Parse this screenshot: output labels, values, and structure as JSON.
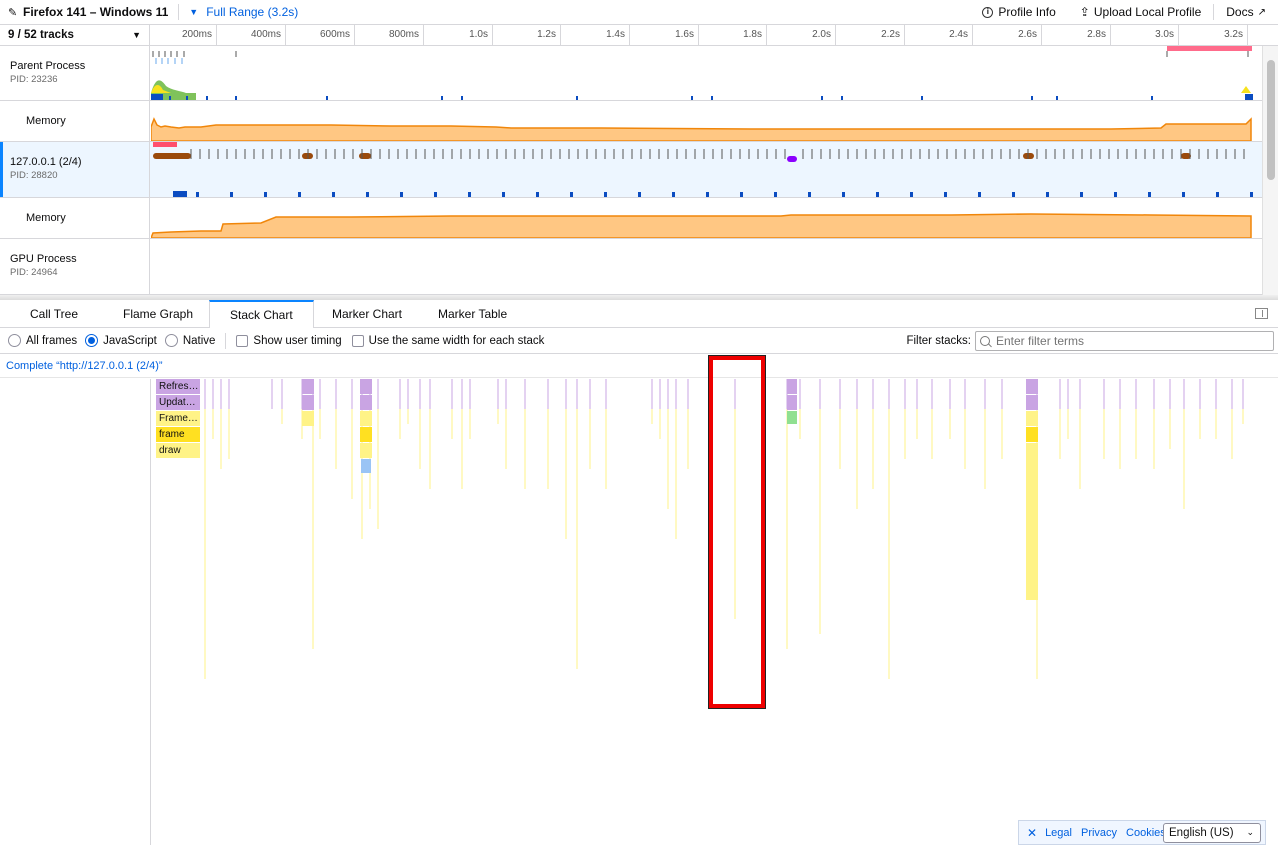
{
  "topbar": {
    "title": "Firefox 141 – Windows 11",
    "range": "Full Range (3.2s)",
    "profile_info": "Profile Info",
    "upload": "Upload Local Profile",
    "docs": "Docs"
  },
  "timeline": {
    "tracks_count": "9 / 52 tracks",
    "ticks": [
      "200ms",
      "400ms",
      "600ms",
      "800ms",
      "1.0s",
      "1.2s",
      "1.4s",
      "1.6s",
      "1.8s",
      "2.0s",
      "2.2s",
      "2.4s",
      "2.6s",
      "2.8s",
      "3.0s",
      "3.2s"
    ],
    "tracks": [
      {
        "name": "Parent Process",
        "pid": "PID: 23236"
      },
      {
        "name": "Memory"
      },
      {
        "name": "127.0.0.1 (2/4)",
        "pid": "PID: 28820"
      },
      {
        "name": "Memory"
      },
      {
        "name": "GPU Process",
        "pid": "PID: 24964"
      }
    ]
  },
  "tabs": [
    "Call Tree",
    "Flame Graph",
    "Stack Chart",
    "Marker Chart",
    "Marker Table"
  ],
  "active_tab": "Stack Chart",
  "settings": {
    "all_frames": "All frames",
    "javascript": "JavaScript",
    "native": "Native",
    "selected": "JavaScript",
    "show_user_timing": "Show user timing",
    "same_width": "Use the same width for each stack",
    "filter_label": "Filter stacks:",
    "filter_placeholder": "Enter filter terms"
  },
  "breadcrumb": "Complete “http://127.0.0.1 (2/4)”",
  "stack_frames": [
    "Refres…",
    "Updat…",
    "Frame…",
    "frame",
    "draw"
  ],
  "footer": {
    "legal": "Legal",
    "privacy": "Privacy",
    "cookies": "Cookies",
    "language": "English (US)"
  },
  "colors": {
    "accent": "#0a84ff",
    "js_purple": "#c9a4e3",
    "js_yellow": "#fff387",
    "js_yellow_dark": "#ffe021",
    "blue_frame": "#9ac4f5",
    "memory_orange": "#ffbd6b",
    "highlight_red": "#ee0000"
  }
}
